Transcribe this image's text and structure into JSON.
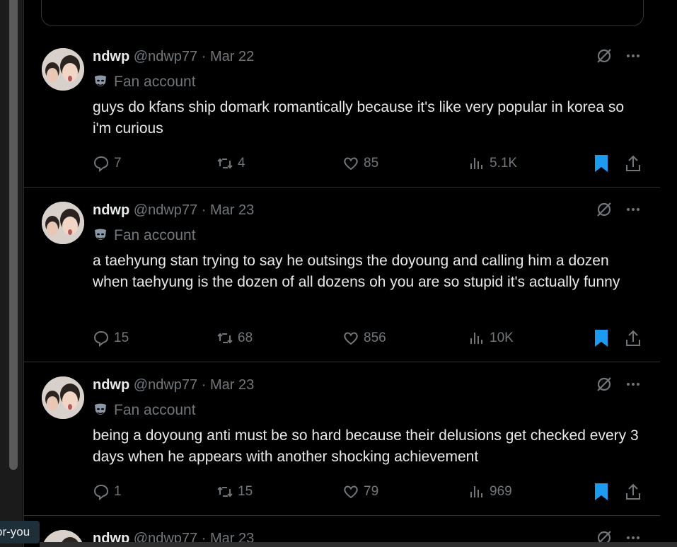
{
  "colors": {
    "background": "#000000",
    "text_primary": "#e7e9ea",
    "text_secondary": "#71767b",
    "bookmark_active": "#1d9bf0",
    "divider": "#2f3336"
  },
  "tooltip": {
    "text": "or-you"
  },
  "tweets": [
    {
      "name": "ndwp",
      "handle": "@ndwp77",
      "separator": "·",
      "date": "Mar 22",
      "badge": "Fan account",
      "text": "guys do kfans ship domark romantically because it's like very popular in korea so i'm curious",
      "replies": "7",
      "reposts": "4",
      "likes": "85",
      "views": "5.1K",
      "bookmarked": true
    },
    {
      "name": "ndwp",
      "handle": "@ndwp77",
      "separator": "·",
      "date": "Mar 23",
      "badge": "Fan account",
      "text": "a taehyung stan trying to say he outsings the doyoung and calling him a dozen when taehyung is the dozen of all dozens oh you are so stupid it's actually funny",
      "replies": "15",
      "reposts": "68",
      "likes": "856",
      "views": "10K",
      "bookmarked": true
    },
    {
      "name": "ndwp",
      "handle": "@ndwp77",
      "separator": "·",
      "date": "Mar 23",
      "badge": "Fan account",
      "text": "being a doyoung anti must be so hard because their delusions get checked every 3 days when he appears with another shocking achievement",
      "replies": "1",
      "reposts": "15",
      "likes": "79",
      "views": "969",
      "bookmarked": true
    },
    {
      "name": "ndwp",
      "handle": "@ndwp77",
      "separator": "·",
      "date": "Mar 23"
    }
  ]
}
